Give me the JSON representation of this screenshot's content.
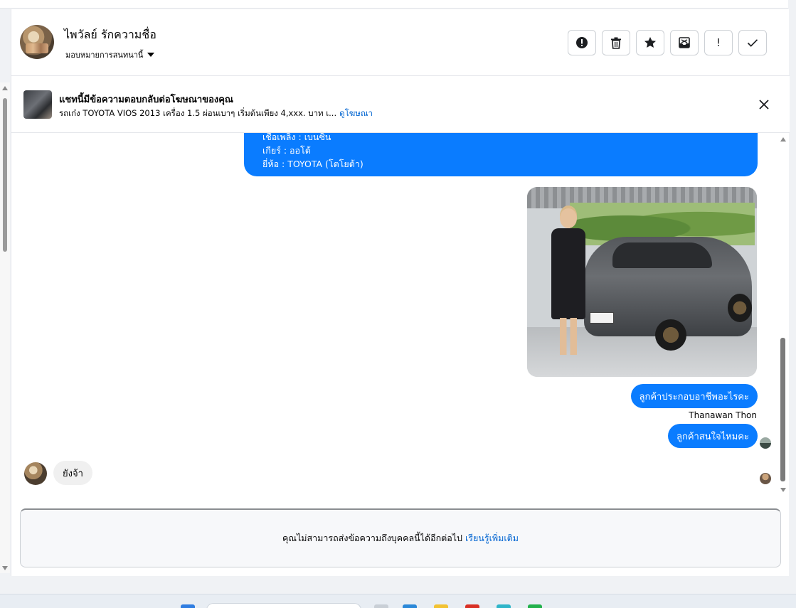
{
  "header": {
    "contact_name": "ไพวัลย์ รักความชื่อ",
    "assign_label": "มอบหมายการสนทนานี้",
    "actions": [
      {
        "name": "report-button",
        "icon": "alert-circle-icon"
      },
      {
        "name": "delete-button",
        "icon": "trash-icon"
      },
      {
        "name": "star-button",
        "icon": "star-icon"
      },
      {
        "name": "archive-button",
        "icon": "archive-icon"
      },
      {
        "name": "flag-button",
        "icon": "exclamation-icon",
        "glyph": "!"
      },
      {
        "name": "done-button",
        "icon": "check-icon"
      }
    ]
  },
  "ad_banner": {
    "title": "แชทนี้มีข้อความตอบกลับต่อโฆษณาของคุณ",
    "description": "รถเก๋ง TOYOTA VIOS 2013 เครื่อง 1.5 ผ่อนเบาๆ เริ่มต้นเพียง 4,xxx. บาท เ...",
    "link": "ดูโฆษณา"
  },
  "messages": {
    "info_lines": [
      "เชื้อเพลิง : เบนซิน",
      "เกียร์ : ออโต้",
      "ยี่ห้อ : TOYOTA (โตโยต้า)"
    ],
    "out_1": "ลูกค้าประกอบอาชีพอะไรคะ",
    "sender_name": "Thanawan Thon",
    "out_2": "ลูกค้าสนใจไหมคะ",
    "in_1": "ยังจ้า"
  },
  "composer": {
    "notice": "คุณไม่สามารถส่งข้อความถึงบุคคลนี้ได้อีกต่อไป",
    "learn_more": "เรียนรู้เพิ่มเติม"
  },
  "colors": {
    "accent": "#0a7cff",
    "link": "#0064d1"
  }
}
